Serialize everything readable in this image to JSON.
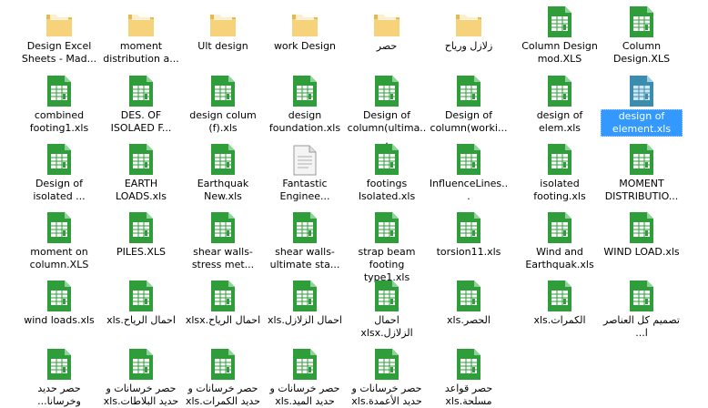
{
  "colors": {
    "folder_front": "#f6d27a",
    "folder_back": "#e8b84a",
    "sheet_green": "#2e9d3a",
    "sheet_light": "#ffffff",
    "selection": "#3399ff"
  },
  "items": [
    {
      "label": "Design Excel Sheets - Mad...",
      "icon": "folder-icon"
    },
    {
      "label": "moment distribution a...",
      "icon": "folder-icon"
    },
    {
      "label": "Ult design",
      "icon": "folder-icon"
    },
    {
      "label": "work Design",
      "icon": "folder-icon"
    },
    {
      "label": "حصر",
      "icon": "folder-icon",
      "rtl": true
    },
    {
      "label": "زلازل ورياح",
      "icon": "folder-icon",
      "rtl": true
    },
    {
      "label": "Column Design mod.XLS",
      "icon": "spreadsheet-icon"
    },
    {
      "label": "Column Design.XLS",
      "icon": "spreadsheet-icon"
    },
    {
      "label": "combined footing1.xls",
      "icon": "spreadsheet-icon"
    },
    {
      "label": "DES. OF ISOLAED F...",
      "icon": "spreadsheet-icon"
    },
    {
      "label": "design colum (f).xls",
      "icon": "spreadsheet-icon"
    },
    {
      "label": "design foundation.xls",
      "icon": "spreadsheet-icon"
    },
    {
      "label": "Design of column(ultima...",
      "icon": "spreadsheet-icon"
    },
    {
      "label": "Design of column(worki...",
      "icon": "spreadsheet-icon"
    },
    {
      "label": "design of elem.xls",
      "icon": "spreadsheet-icon"
    },
    {
      "label": "design of element.xls",
      "icon": "spreadsheet-icon",
      "selected": true
    },
    {
      "label": "Design of isolated ...",
      "icon": "spreadsheet-icon"
    },
    {
      "label": "EARTH LOADS.xls",
      "icon": "spreadsheet-icon"
    },
    {
      "label": "Earthquak New.xls",
      "icon": "spreadsheet-icon"
    },
    {
      "label": "Fantastic Enginee...",
      "icon": "text-file-icon"
    },
    {
      "label": "footings Isolated.xls",
      "icon": "spreadsheet-icon"
    },
    {
      "label": "InfluenceLines...",
      "icon": "spreadsheet-icon"
    },
    {
      "label": "isolated footing.xls",
      "icon": "spreadsheet-icon"
    },
    {
      "label": "MOMENT DISTRIBUTIO...",
      "icon": "spreadsheet-icon"
    },
    {
      "label": "moment on column.XLS",
      "icon": "spreadsheet-icon"
    },
    {
      "label": "PILES.XLS",
      "icon": "spreadsheet-icon"
    },
    {
      "label": "shear walls-stress met...",
      "icon": "spreadsheet-icon"
    },
    {
      "label": "shear walls-ultimate sta...",
      "icon": "spreadsheet-icon"
    },
    {
      "label": "strap beam footing type1.xls",
      "icon": "spreadsheet-icon"
    },
    {
      "label": "torsion11.xls",
      "icon": "spreadsheet-icon"
    },
    {
      "label": "Wind and Earthquak.xls",
      "icon": "spreadsheet-icon"
    },
    {
      "label": "WIND LOAD.xls",
      "icon": "spreadsheet-icon"
    },
    {
      "label": "wind loads.xls",
      "icon": "spreadsheet-icon"
    },
    {
      "label": "احمال الرياح.xls",
      "icon": "spreadsheet-icon",
      "rtl": true
    },
    {
      "label": "احمال الرياح.xlsx",
      "icon": "spreadsheet-icon",
      "rtl": true
    },
    {
      "label": "احمال الزلازل.xls",
      "icon": "spreadsheet-icon",
      "rtl": true
    },
    {
      "label": "احمال الزلازل.xlsx",
      "icon": "spreadsheet-icon",
      "rtl": true
    },
    {
      "label": "الحصر.xls",
      "icon": "spreadsheet-icon",
      "rtl": true
    },
    {
      "label": "الكمرات.xls",
      "icon": "spreadsheet-icon",
      "rtl": true
    },
    {
      "label": "تصميم كل العناصر ا...",
      "icon": "spreadsheet-icon",
      "rtl": true
    },
    {
      "label": "حصر حديد وخرسانا...",
      "icon": "spreadsheet-icon",
      "rtl": true
    },
    {
      "label": "حصر خرسانات و حديد البلاطات.xls",
      "icon": "spreadsheet-icon",
      "rtl": true
    },
    {
      "label": "حصر خرسانات و حديد الكمرات.xls",
      "icon": "spreadsheet-icon",
      "rtl": true
    },
    {
      "label": "حصر خرسانات و حديد الميد.xls",
      "icon": "spreadsheet-icon",
      "rtl": true
    },
    {
      "label": "حصر خرسانات و حديد الأعمدة.xls",
      "icon": "spreadsheet-icon",
      "rtl": true
    },
    {
      "label": "حصر قواعد مسلحة.xls",
      "icon": "spreadsheet-icon",
      "rtl": true
    }
  ]
}
